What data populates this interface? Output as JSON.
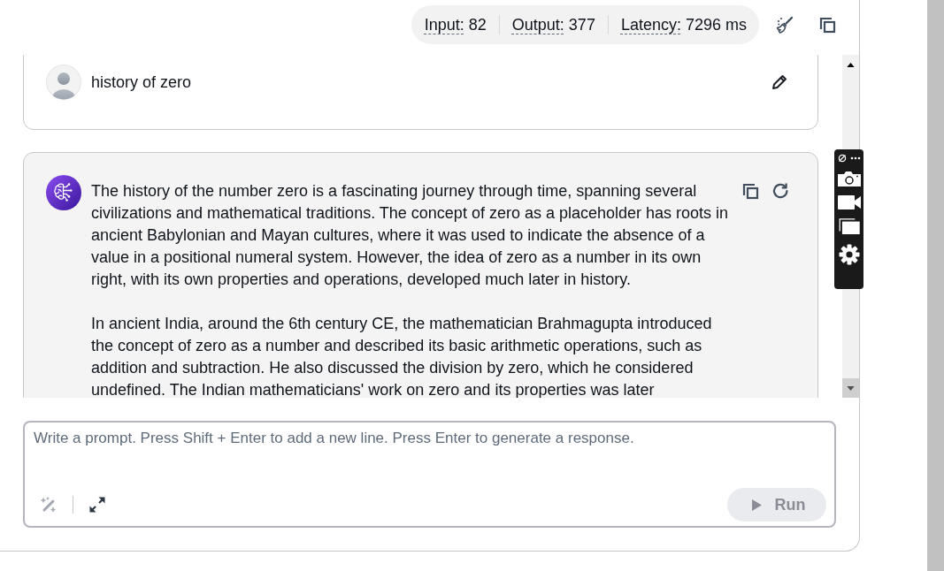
{
  "metrics": [
    {
      "label": "Input:",
      "value": "82"
    },
    {
      "label": "Output:",
      "value": "377"
    },
    {
      "label": "Latency:",
      "value": "7296 ms"
    }
  ],
  "conversation": {
    "messages": [
      {
        "kind": "user",
        "text": "history of zero"
      },
      {
        "kind": "assistant",
        "paragraphs": [
          "The history of the number zero is a fascinating journey through time, spanning several civilizations and mathematical traditions. The concept of zero as a placeholder has roots in ancient Babylonian and Mayan cultures, where it was used to indicate the absence of a value in a positional numeral system. However, the idea of zero as a number in its own right, with its own properties and operations, developed much later in history.",
          "In ancient India, around the 6th century CE, the mathematician Brahmagupta introduced the concept of zero as a number and described its basic arithmetic operations, such as addition and subtraction. He also discussed the division by zero, which he considered undefined. The Indian mathematicians' work on zero and its properties was later"
        ]
      }
    ]
  },
  "prompt": {
    "placeholder": "Write a prompt. Press Shift + Enter to add a new line. Press Enter to generate a response.",
    "tools": [
      {
        "kind": "enhance",
        "disabled": true
      },
      {
        "kind": "expand",
        "disabled": false
      }
    ],
    "run_button": {
      "label": "Run",
      "disabled": true
    }
  }
}
